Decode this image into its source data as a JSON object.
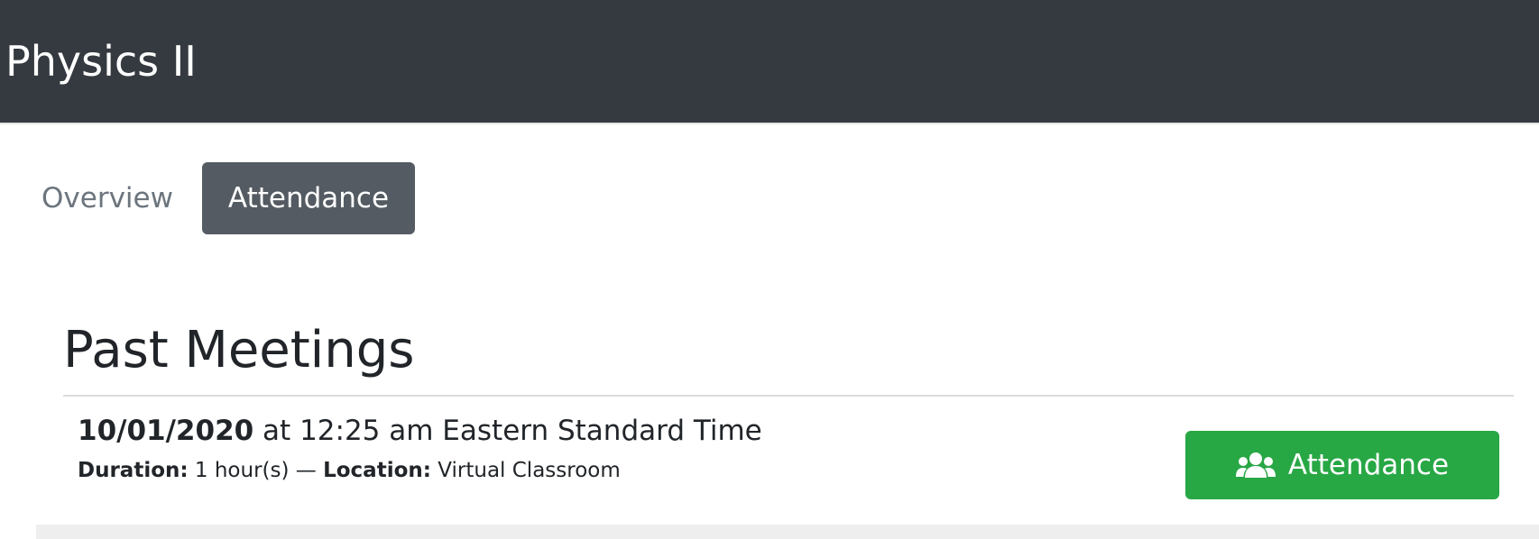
{
  "header": {
    "title": "Physics II"
  },
  "tabs": [
    {
      "label": "Overview",
      "active": false
    },
    {
      "label": "Attendance",
      "active": true
    }
  ],
  "section": {
    "title": "Past Meetings"
  },
  "meetings": [
    {
      "date": "10/01/2020",
      "time_text": " at 12:25 am Eastern Standard Time",
      "duration_label": "Duration:",
      "duration_value": " 1 hour(s) — ",
      "location_label": "Location:",
      "location_value": " Virtual Classroom",
      "action_label": "Attendance",
      "action_icon": "users-icon"
    }
  ],
  "colors": {
    "header_bg": "#343a40",
    "active_tab_bg": "#545b62",
    "inactive_tab_text": "#6c757d",
    "action_button_bg": "#28a745"
  }
}
